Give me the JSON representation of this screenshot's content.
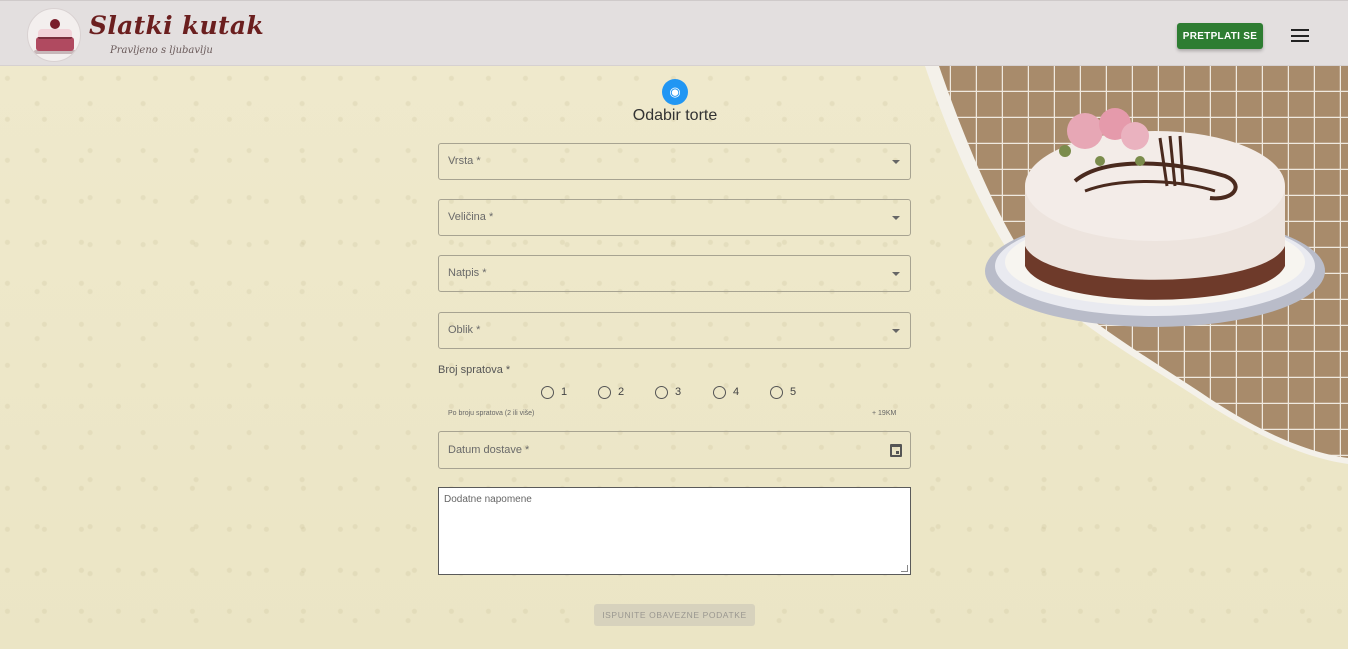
{
  "header": {
    "brand_title": "Slatki kutak",
    "brand_subtitle": "Pravljeno s ljubavlju",
    "subscribe_label": "PRETPLATI SE",
    "menu_icon": "hamburger-menu-icon"
  },
  "form": {
    "step_icon": "cake-icon",
    "title": "Odabir torte",
    "fields": {
      "type_label": "Vrsta *",
      "size_label": "Veličina *",
      "inscription_label": "Natpis *",
      "shape_label": "Oblik *"
    },
    "floors": {
      "label": "Broj spratova *",
      "options": [
        "1",
        "2",
        "3",
        "4",
        "5"
      ],
      "hint": "Po broju spratova (2 ili više)",
      "hint_price": "+ 19KM"
    },
    "date_label": "Datum dostave *",
    "notes_placeholder": "Dodatne napomene",
    "submit_label": "ISPUNITE OBAVEZNE PODATKE"
  },
  "colors": {
    "accent_green": "#2e7d32",
    "step_blue": "#2196f3",
    "brand_maroon": "#6b1f1f",
    "background": "#ede7c8"
  }
}
